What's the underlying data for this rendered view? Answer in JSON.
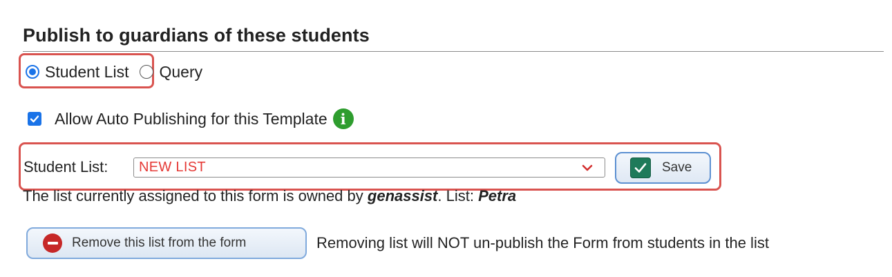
{
  "section": {
    "title": "Publish to guardians of these students"
  },
  "publish_mode": {
    "options": [
      {
        "label": "Student List",
        "selected": true
      },
      {
        "label": "Query",
        "selected": false
      }
    ]
  },
  "auto_publish": {
    "label": "Allow Auto Publishing for this Template",
    "checked": true,
    "info_icon": "info-icon"
  },
  "student_list": {
    "label": "Student List:",
    "selected_value": "NEW LIST",
    "save_label": "Save"
  },
  "ownership": {
    "prefix": "The list currently assigned to this form is owned by ",
    "owner": "genassist",
    "list_prefix": ". List: ",
    "list_name": "Petra"
  },
  "remove": {
    "button_label": "Remove this list from the form",
    "note": "Removing list will NOT un-publish the Form from students in the list"
  },
  "colors": {
    "highlight": "#d9534f",
    "accent": "#1a73e8",
    "select_text": "#e53935",
    "info_green": "#2e9d2e",
    "remove_red": "#c62828"
  }
}
